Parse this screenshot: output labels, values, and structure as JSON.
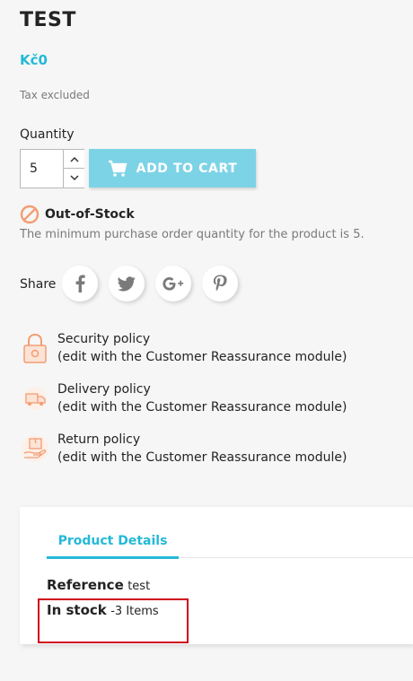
{
  "product": {
    "title": "TEST",
    "price": "Kč0",
    "tax_note": "Tax excluded"
  },
  "quantity": {
    "label": "Quantity",
    "value": "5"
  },
  "cart": {
    "button_label": "ADD TO CART"
  },
  "availability": {
    "status": "Out-of-Stock",
    "min_message": "The minimum purchase order quantity for the product is 5."
  },
  "share": {
    "label": "Share",
    "networks": [
      "facebook",
      "twitter",
      "google-plus",
      "pinterest"
    ]
  },
  "reassurance": [
    {
      "title": "Security policy",
      "note": "(edit with the Customer Reassurance module)",
      "icon": "lock-icon"
    },
    {
      "title": "Delivery policy",
      "note": "(edit with the Customer Reassurance module)",
      "icon": "truck-icon"
    },
    {
      "title": "Return policy",
      "note": "(edit with the Customer Reassurance module)",
      "icon": "return-box-icon"
    }
  ],
  "details": {
    "tab_label": "Product Details",
    "reference_label": "Reference",
    "reference_value": "test",
    "stock_label": "In stock",
    "stock_value": "-3 Items"
  },
  "colors": {
    "accent": "#24b9d7",
    "cart_button": "#7dd3e6",
    "out_of_stock": "#f39d72",
    "highlight_border": "#d0021b"
  }
}
